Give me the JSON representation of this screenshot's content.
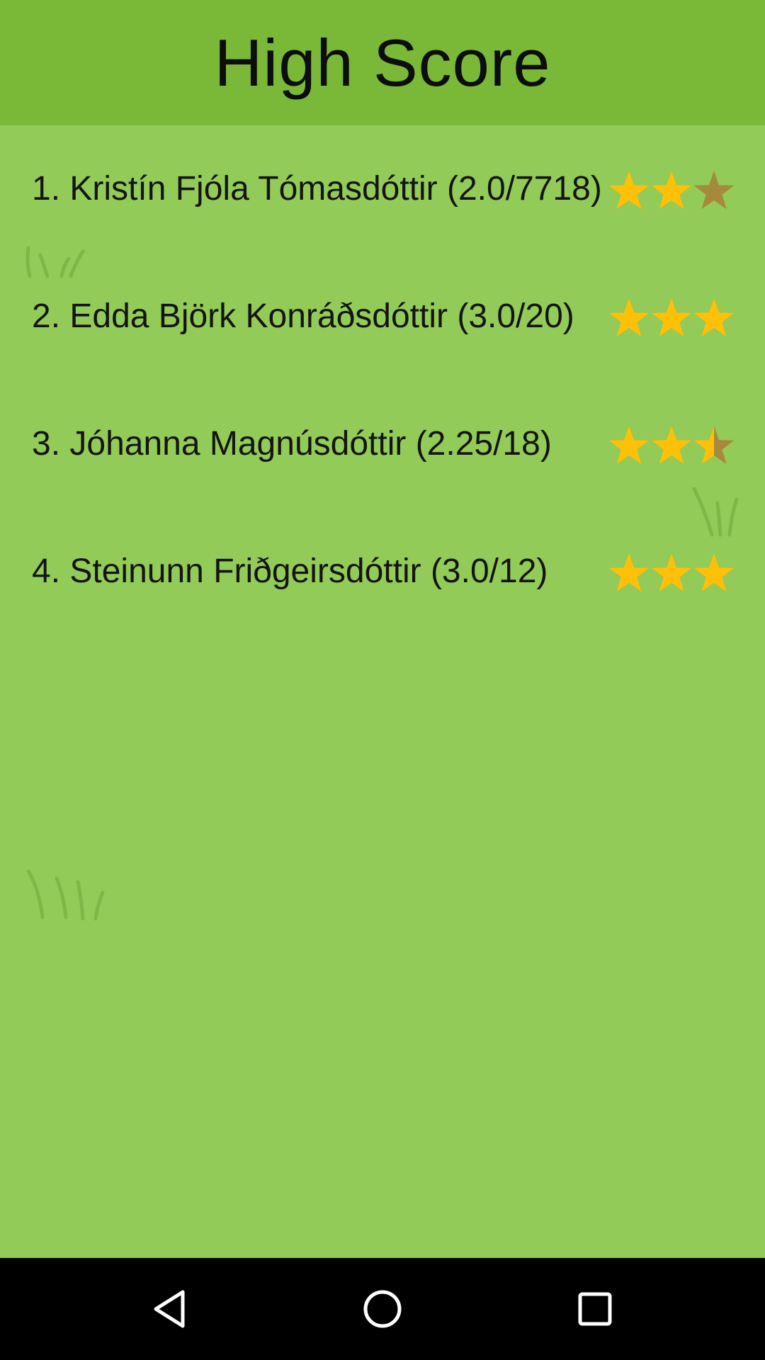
{
  "header": {
    "title": "High Score"
  },
  "scores": [
    {
      "text": "1. Kristín Fjóla Tómasdóttir  (2.0/7718)",
      "stars": 2
    },
    {
      "text": "2. Edda Björk Konráðsdóttir  (3.0/20)",
      "stars": 3
    },
    {
      "text": "3. Jóhanna Magnúsdóttir  (2.25/18)",
      "stars": 2.5
    },
    {
      "text": "4. Steinunn Friðgeirsdóttir  (3.0/12)",
      "stars": 3
    }
  ],
  "star_max": 3,
  "colors": {
    "background": "#92cb57",
    "header": "#7ab837",
    "star_filled": "#ffc107",
    "star_empty": "#a68a3c",
    "grass": "#6fa83a"
  },
  "icons": {
    "nav_back": "back-triangle-icon",
    "nav_home": "home-circle-icon",
    "nav_recents": "recents-square-icon",
    "decoration": "grass-tuft-icon",
    "rating": "star-icon"
  }
}
